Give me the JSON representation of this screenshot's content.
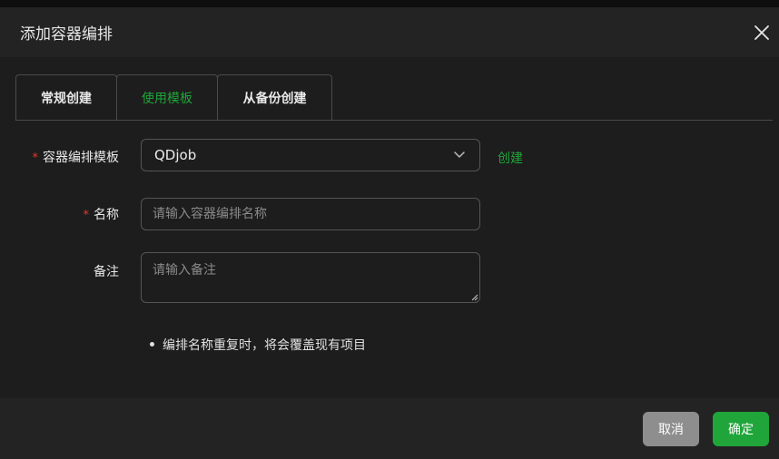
{
  "dialog": {
    "title": "添加容器编排",
    "close_icon": "close-icon"
  },
  "tabs": [
    {
      "label": "常规创建",
      "active": false
    },
    {
      "label": "使用模板",
      "active": true
    },
    {
      "label": "从备份创建",
      "active": false
    }
  ],
  "form": {
    "template": {
      "label": "容器编排模板",
      "required": true,
      "value": "QDjob",
      "create_link": "创建"
    },
    "name": {
      "label": "名称",
      "required": true,
      "placeholder": "请输入容器编排名称"
    },
    "remark": {
      "label": "备注",
      "required": false,
      "placeholder": "请输入备注"
    },
    "hint": "编排名称重复时，将会覆盖现有项目"
  },
  "footer": {
    "cancel_label": "取消",
    "ok_label": "确定"
  },
  "colors": {
    "accent": "#20a53a",
    "required": "#e0392a",
    "cancel": "#8e8e8e"
  }
}
